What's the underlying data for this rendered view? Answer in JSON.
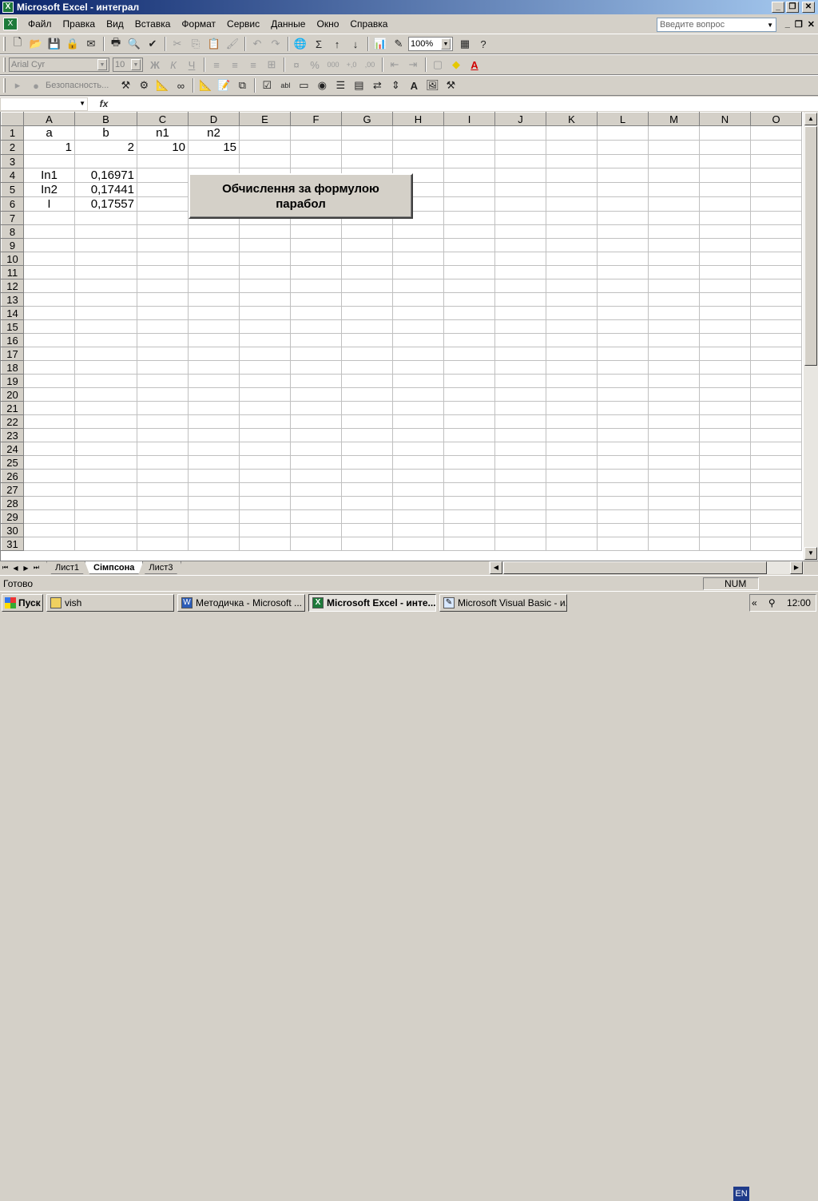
{
  "window": {
    "title": "Microsoft Excel - интеграл",
    "app_icon": "excel-icon"
  },
  "menu": {
    "items": [
      "Файл",
      "Правка",
      "Вид",
      "Вставка",
      "Формат",
      "Сервис",
      "Данные",
      "Окно",
      "Справка"
    ]
  },
  "help": {
    "placeholder": "Введите вопрос"
  },
  "standard_toolbar": {
    "zoom": "100%"
  },
  "format_toolbar": {
    "font": "Arial Cyr",
    "size": "10"
  },
  "controls_toolbar": {
    "security_label": "Безопасность..."
  },
  "formula_bar": {
    "fx": "fx",
    "name_box": "",
    "content": ""
  },
  "sheet": {
    "columns": [
      "A",
      "B",
      "C",
      "D",
      "E",
      "F",
      "G",
      "H",
      "I",
      "J",
      "K",
      "L",
      "M",
      "N",
      "O"
    ],
    "row_count": 31,
    "cells": {
      "A1": "a",
      "B1": "b",
      "C1": "n1",
      "D1": "n2",
      "A2": "1",
      "B2": "2",
      "C2": "10",
      "D2": "15",
      "A4": "In1",
      "B4": "0,16971",
      "A5": "In2",
      "B5": "0,17441",
      "A6": "I",
      "B6": "0,17557"
    }
  },
  "macro_button": {
    "label": "Обчислення за формулою парабол"
  },
  "tabs": {
    "items": [
      "Лист1",
      "Сімпсона",
      "Лист3"
    ],
    "active": "Сімпсона"
  },
  "status": {
    "ready": "Готово",
    "num": "NUM"
  },
  "taskbar": {
    "start": "Пуск",
    "tasks": [
      {
        "label": "vish",
        "icon": "folder-icon"
      },
      {
        "label": "Методичка - Microsoft ...",
        "icon": "word-icon"
      },
      {
        "label": "Microsoft Excel - инте...",
        "icon": "excel-icon"
      },
      {
        "label": "Microsoft Visual Basic - и...",
        "icon": "vba-icon"
      }
    ],
    "lang": "EN",
    "time": "12:00"
  }
}
